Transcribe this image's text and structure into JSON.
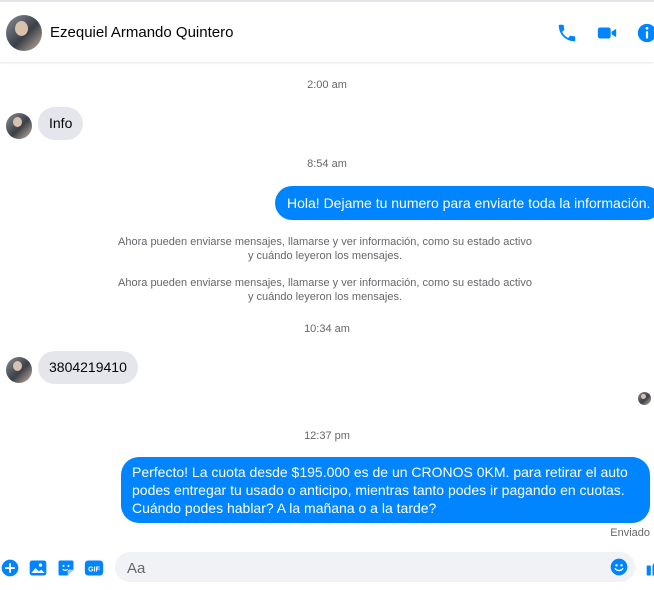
{
  "header": {
    "contact_name": "Ezequiel Armando Quintero",
    "icons": [
      "phone-icon",
      "video-icon",
      "info-icon"
    ]
  },
  "messages": {
    "ts1": "2:00 am",
    "in1": "Info",
    "ts2": "8:54 am",
    "out1": "Hola! Dejame tu numero  para enviarte toda la información.",
    "sys1_line1": "Ahora pueden enviarse mensajes, llamarse y ver información, como su estado activo",
    "sys1_line2": "y cuándo leyeron los mensajes.",
    "sys2_line1": "Ahora pueden enviarse mensajes, llamarse y ver información, como su estado activo",
    "sys2_line2": "y cuándo leyeron los mensajes.",
    "ts3": "10:34 am",
    "in2": "3804219410",
    "ts4": "12:37 pm",
    "out2": "Perfecto! La cuota desde $195.000 es de un CRONOS 0KM. para retirar el auto podes entregar tu usado o anticipo, mientras tanto podes ir pagando en cuotas. Cuándo podes hablar? A la mañana o a la tarde?",
    "status": "Enviado"
  },
  "composer": {
    "placeholder": "Aa",
    "gif_label": "GIF",
    "icons": [
      "add-icon",
      "image-icon",
      "sticker-icon",
      "gif-icon",
      "emoji-icon",
      "like-icon"
    ]
  },
  "colors": {
    "accent": "#0084ff",
    "incoming_bubble": "#e4e6eb",
    "secondary_text": "#65676b"
  }
}
